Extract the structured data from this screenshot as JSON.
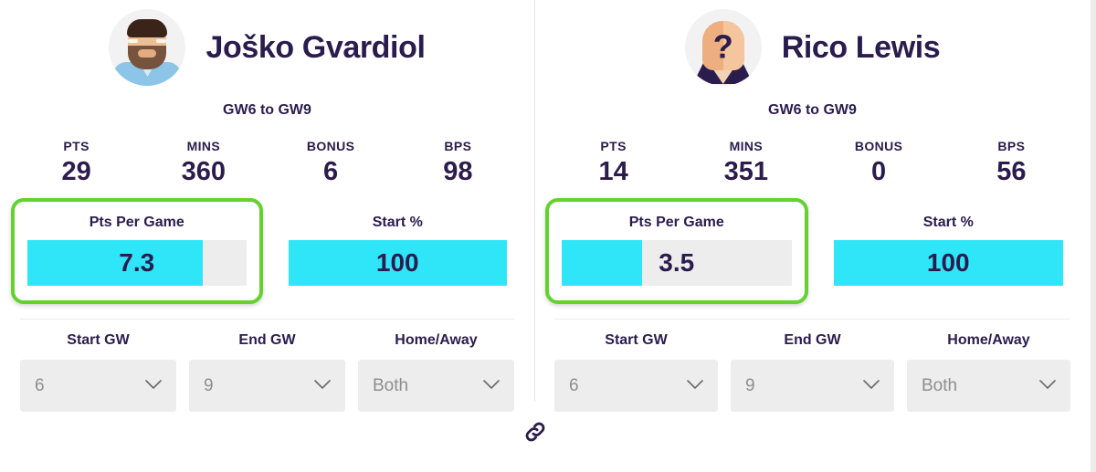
{
  "players": [
    {
      "name": "Joško Gvardiol",
      "avatar_icon": "player-photo-avatar",
      "gw_range": "GW6 to GW9",
      "stats": [
        {
          "label": "PTS",
          "value": "29"
        },
        {
          "label": "MINS",
          "value": "360"
        },
        {
          "label": "BONUS",
          "value": "6"
        },
        {
          "label": "BPS",
          "value": "98"
        }
      ],
      "metrics": [
        {
          "label": "Pts Per Game",
          "value": "7.3",
          "fill_pct": 80,
          "highlighted": true
        },
        {
          "label": "Start %",
          "value": "100",
          "fill_pct": 100,
          "highlighted": false
        }
      ],
      "filters": [
        {
          "label": "Start GW",
          "value": "6"
        },
        {
          "label": "End GW",
          "value": "9"
        },
        {
          "label": "Home/Away",
          "value": "Both"
        }
      ]
    },
    {
      "name": "Rico Lewis",
      "avatar_icon": "unknown-player-avatar",
      "avatar_glyph": "?",
      "gw_range": "GW6 to GW9",
      "stats": [
        {
          "label": "PTS",
          "value": "14"
        },
        {
          "label": "MINS",
          "value": "351"
        },
        {
          "label": "BONUS",
          "value": "0"
        },
        {
          "label": "BPS",
          "value": "56"
        }
      ],
      "metrics": [
        {
          "label": "Pts Per Game",
          "value": "3.5",
          "fill_pct": 35,
          "highlighted": true
        },
        {
          "label": "Start %",
          "value": "100",
          "fill_pct": 100,
          "highlighted": false
        }
      ],
      "filters": [
        {
          "label": "Start GW",
          "value": "6"
        },
        {
          "label": "End GW",
          "value": "9"
        },
        {
          "label": "Home/Away",
          "value": "Both"
        }
      ]
    }
  ],
  "link_filters": {
    "icon": "link-icon",
    "tooltip": "Link filters"
  },
  "colors": {
    "bar_fill": "#2fe5f8",
    "bar_track": "#ededed",
    "highlight_border": "#63d32c",
    "text_dark": "#2b1c4e",
    "select_bg": "#ededed",
    "select_text": "#8e8e8e"
  }
}
